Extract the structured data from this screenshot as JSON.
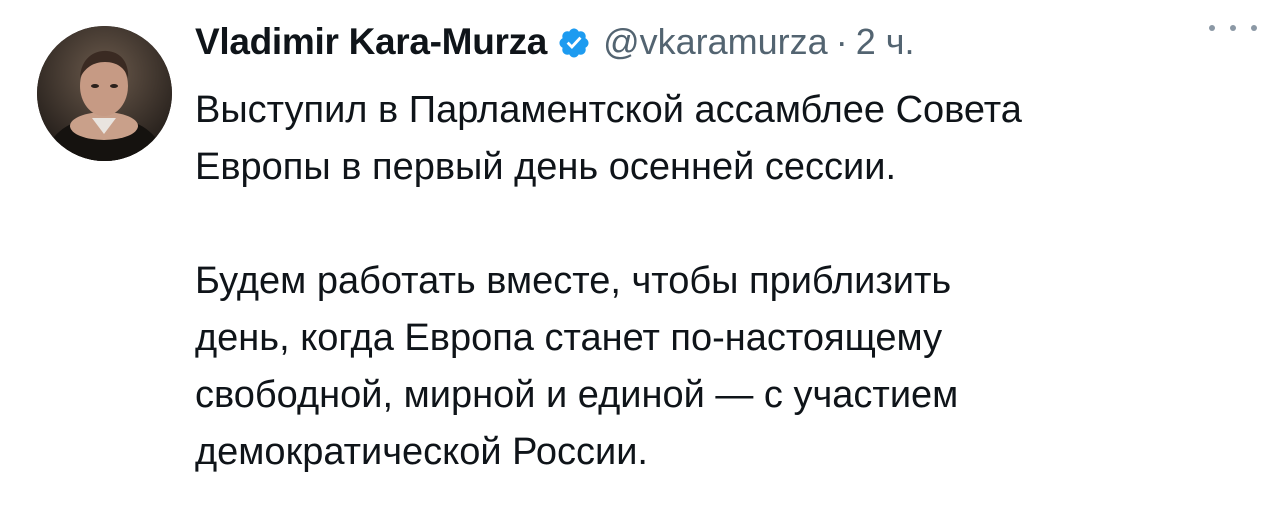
{
  "tweet": {
    "author": {
      "name": "Vladimir Kara-Murza",
      "handle": "@vkaramurza",
      "verified": true,
      "verified_color": "#1d9bf0"
    },
    "separator": "·",
    "time": "2 ч.",
    "more_icon": "more-horizontal-icon",
    "paragraphs": [
      {
        "lines": [
          "Выступил в Парламентской ассамблее Совета",
          "Европы в первый день осенней сессии."
        ]
      },
      {
        "lines": [
          "Будем работать вместе, чтобы приблизить",
          "день, когда Европа станет по-настоящему",
          "свободной, мирной и единой — с участием",
          "демократической России."
        ]
      }
    ]
  }
}
